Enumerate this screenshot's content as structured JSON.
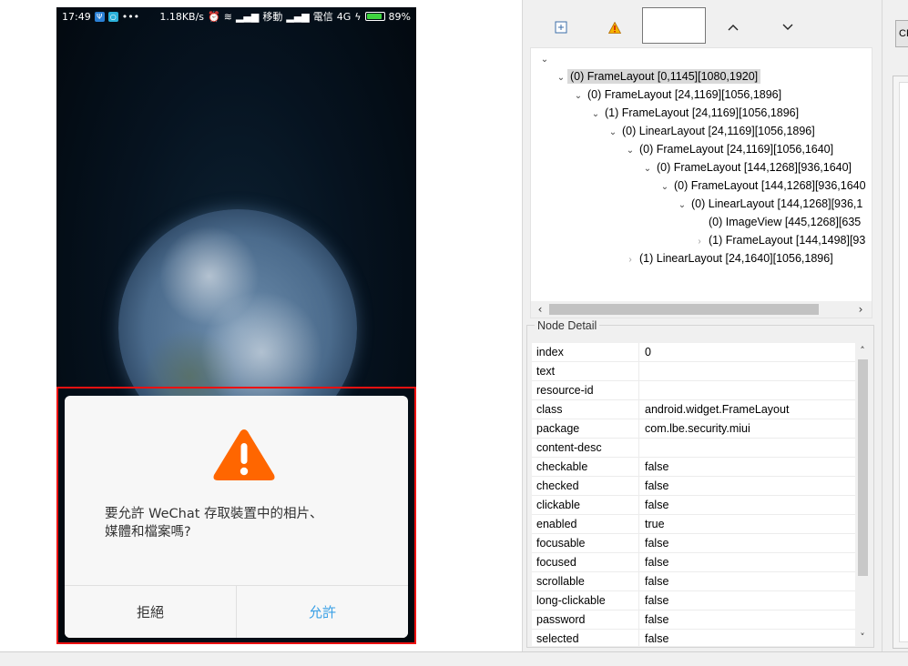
{
  "status_bar": {
    "time": "17:49",
    "icons": [
      "psi-icon",
      "app-icon",
      "more-dots"
    ],
    "speed": "1.18KB/s",
    "carrier1": "移動",
    "carrier2": "電信",
    "network": "4G",
    "battery": "89%"
  },
  "dialog": {
    "message": "要允許 WeChat 存取裝置中的相片、\n媒體和檔案嗎?",
    "deny_label": "拒絕",
    "allow_label": "允許",
    "allow_color": "#3aa0e6",
    "warning_color": "#ff6600"
  },
  "toolbar": {
    "search_value": ""
  },
  "tree": [
    {
      "label": "(0) FrameLayout [0,1145][1080,1920]",
      "depth": 0,
      "expanded": true,
      "selected": true
    },
    {
      "label": "(0) FrameLayout [24,1169][1056,1896]",
      "depth": 1,
      "expanded": true
    },
    {
      "label": "(1) FrameLayout [24,1169][1056,1896]",
      "depth": 2,
      "expanded": true
    },
    {
      "label": "(0) LinearLayout [24,1169][1056,1896]",
      "depth": 3,
      "expanded": true
    },
    {
      "label": "(0) FrameLayout [24,1169][1056,1640]",
      "depth": 4,
      "expanded": true
    },
    {
      "label": "(0) FrameLayout [144,1268][936,1640]",
      "depth": 5,
      "expanded": true
    },
    {
      "label": "(0) FrameLayout [144,1268][936,1640",
      "depth": 6,
      "expanded": true
    },
    {
      "label": "(0) LinearLayout [144,1268][936,1",
      "depth": 7,
      "expanded": true
    },
    {
      "label": "(0) ImageView [445,1268][635",
      "depth": 8,
      "leaf": true
    },
    {
      "label": "(1) FrameLayout [144,1498][93",
      "depth": 8,
      "expanded": false
    },
    {
      "label": "(1) LinearLayout [24,1640][1056,1896]",
      "depth": 4,
      "expanded": false
    }
  ],
  "node_detail": {
    "title": "Node Detail",
    "rows": [
      {
        "key": "index",
        "value": "0"
      },
      {
        "key": "text",
        "value": ""
      },
      {
        "key": "resource-id",
        "value": ""
      },
      {
        "key": "class",
        "value": "android.widget.FrameLayout"
      },
      {
        "key": "package",
        "value": "com.lbe.security.miui"
      },
      {
        "key": "content-desc",
        "value": ""
      },
      {
        "key": "checkable",
        "value": "false"
      },
      {
        "key": "checked",
        "value": "false"
      },
      {
        "key": "clickable",
        "value": "false"
      },
      {
        "key": "enabled",
        "value": "true"
      },
      {
        "key": "focusable",
        "value": "false"
      },
      {
        "key": "focused",
        "value": "false"
      },
      {
        "key": "scrollable",
        "value": "false"
      },
      {
        "key": "long-clickable",
        "value": "false"
      },
      {
        "key": "password",
        "value": "false"
      },
      {
        "key": "selected",
        "value": "false"
      }
    ]
  },
  "far_right": {
    "cp_label": "CP"
  }
}
